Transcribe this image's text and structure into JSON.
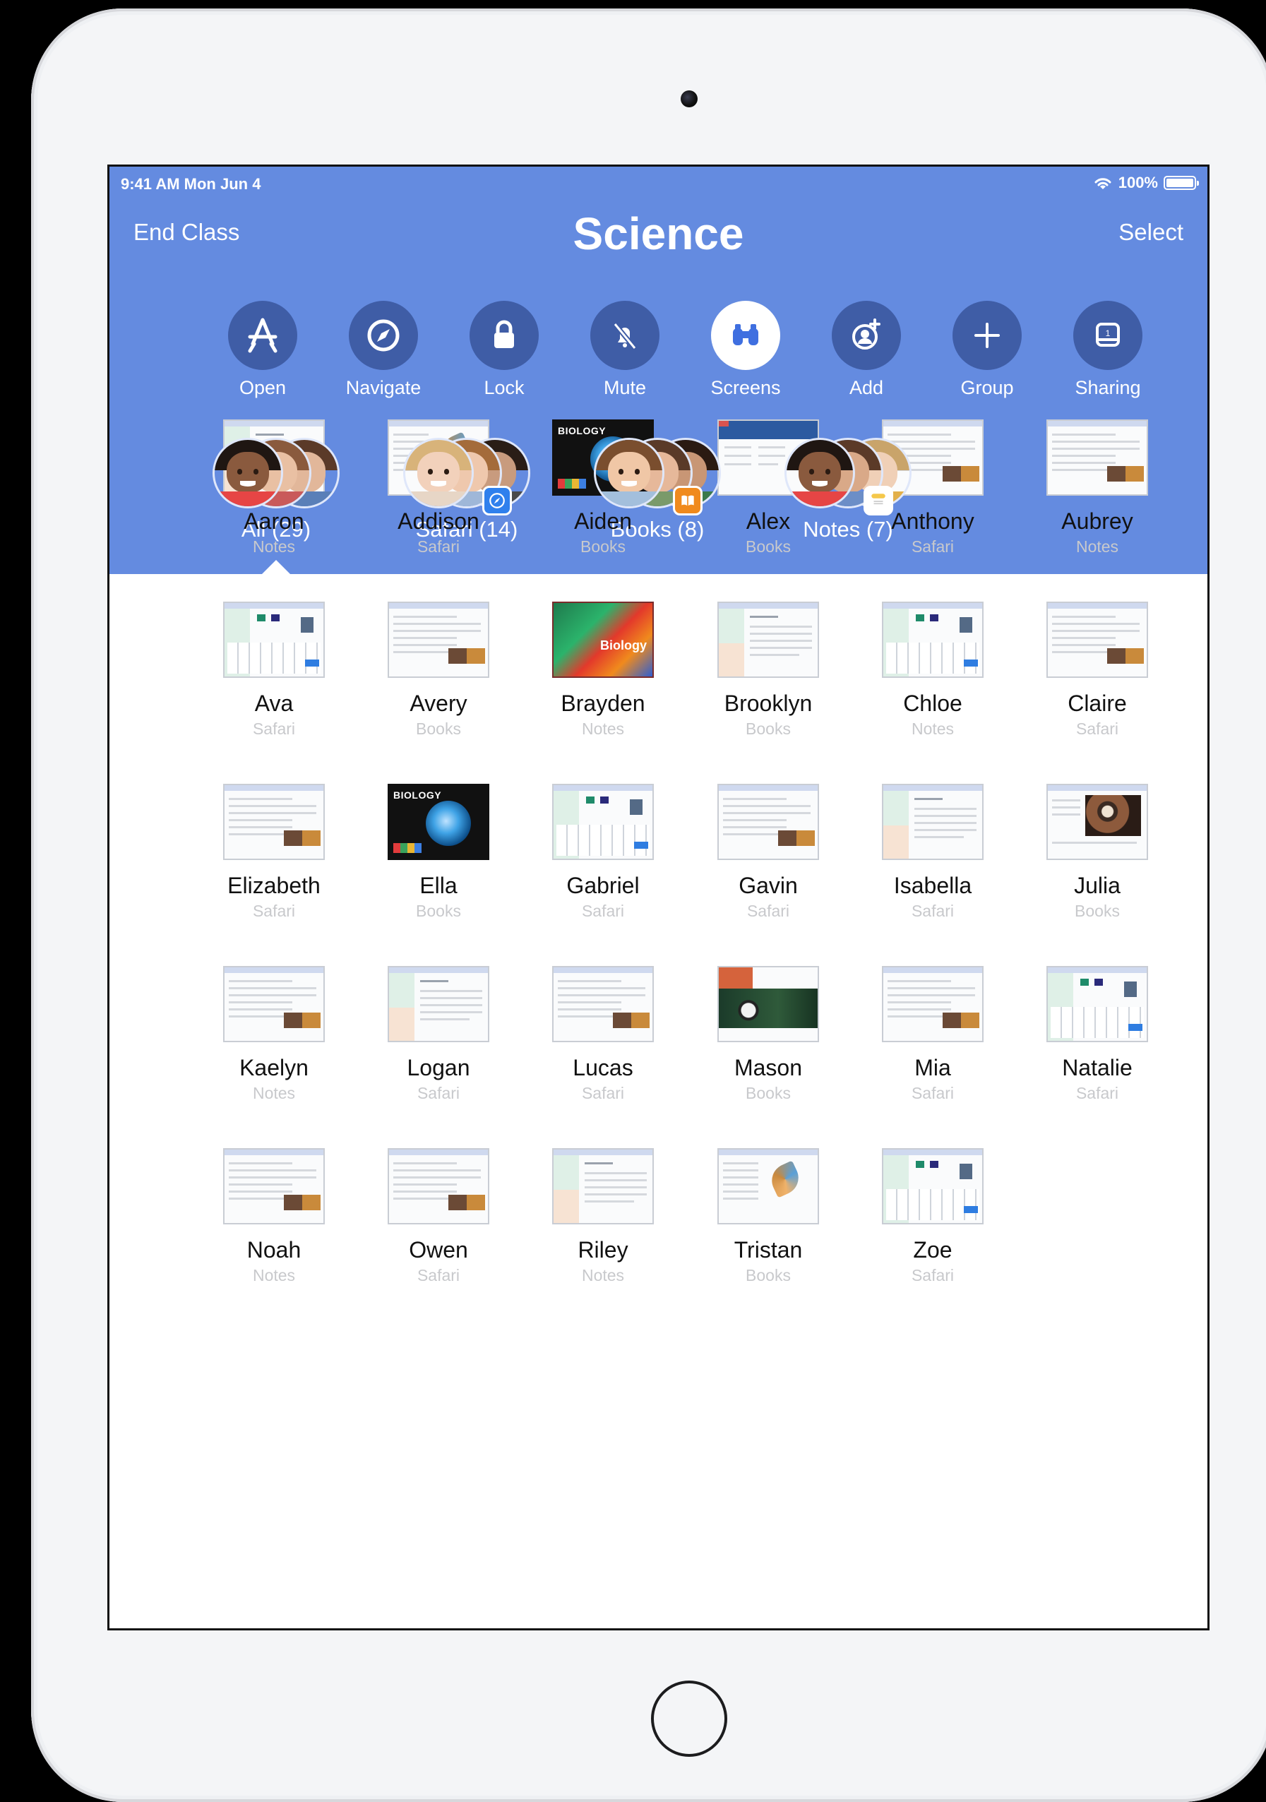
{
  "status": {
    "time": "9:41 AM   Mon Jun 4",
    "battery": "100%"
  },
  "nav": {
    "left": "End Class",
    "title": "Science",
    "right": "Select"
  },
  "tools": [
    {
      "label": "Open",
      "icon": "app-store-icon",
      "active": false
    },
    {
      "label": "Navigate",
      "icon": "compass-icon",
      "active": false
    },
    {
      "label": "Lock",
      "icon": "lock-icon",
      "active": false
    },
    {
      "label": "Mute",
      "icon": "mute-bell-icon",
      "active": false
    },
    {
      "label": "Screens",
      "icon": "binoculars-icon",
      "active": true
    },
    {
      "label": "Add",
      "icon": "add-person-icon",
      "active": false
    },
    {
      "label": "Group",
      "icon": "plus-icon",
      "active": false
    },
    {
      "label": "Sharing",
      "icon": "apple-tv-icon",
      "active": false
    }
  ],
  "filters": [
    {
      "label": "All (29)",
      "badge": null
    },
    {
      "label": "Safari (14)",
      "badge": "safari-badge-icon"
    },
    {
      "label": "Books (8)",
      "badge": "books-badge-icon"
    },
    {
      "label": "Notes (7)",
      "badge": "notes-badge-icon"
    }
  ],
  "students": [
    {
      "name": "Aaron",
      "app": "Notes",
      "thumb": "notes"
    },
    {
      "name": "Addison",
      "app": "Safari",
      "thumb": "bird"
    },
    {
      "name": "Aiden",
      "app": "Books",
      "thumb": "bio-dark"
    },
    {
      "name": "Alex",
      "app": "Books",
      "thumb": "web-blue"
    },
    {
      "name": "Anthony",
      "app": "Safari",
      "thumb": "web-img"
    },
    {
      "name": "Aubrey",
      "app": "Notes",
      "thumb": "web-img"
    },
    {
      "name": "Ava",
      "app": "Safari",
      "thumb": "keyboard"
    },
    {
      "name": "Avery",
      "app": "Books",
      "thumb": "web-img"
    },
    {
      "name": "Brayden",
      "app": "Notes",
      "thumb": "parrot"
    },
    {
      "name": "Brooklyn",
      "app": "Books",
      "thumb": "notes"
    },
    {
      "name": "Chloe",
      "app": "Notes",
      "thumb": "keyboard"
    },
    {
      "name": "Claire",
      "app": "Safari",
      "thumb": "web-img"
    },
    {
      "name": "Elizabeth",
      "app": "Safari",
      "thumb": "web-img"
    },
    {
      "name": "Ella",
      "app": "Books",
      "thumb": "bio-dark"
    },
    {
      "name": "Gabriel",
      "app": "Safari",
      "thumb": "keyboard"
    },
    {
      "name": "Gavin",
      "app": "Safari",
      "thumb": "web-img"
    },
    {
      "name": "Isabella",
      "app": "Safari",
      "thumb": "notes"
    },
    {
      "name": "Julia",
      "app": "Books",
      "thumb": "julia"
    },
    {
      "name": "Kaelyn",
      "app": "Notes",
      "thumb": "web-img"
    },
    {
      "name": "Logan",
      "app": "Safari",
      "thumb": "notes"
    },
    {
      "name": "Lucas",
      "app": "Safari",
      "thumb": "web-img"
    },
    {
      "name": "Mason",
      "app": "Books",
      "thumb": "mason"
    },
    {
      "name": "Mia",
      "app": "Safari",
      "thumb": "web-img"
    },
    {
      "name": "Natalie",
      "app": "Safari",
      "thumb": "keyboard"
    },
    {
      "name": "Noah",
      "app": "Notes",
      "thumb": "web-img"
    },
    {
      "name": "Owen",
      "app": "Safari",
      "thumb": "web-img"
    },
    {
      "name": "Riley",
      "app": "Notes",
      "thumb": "notes"
    },
    {
      "name": "Tristan",
      "app": "Books",
      "thumb": "bird"
    },
    {
      "name": "Zoe",
      "app": "Safari",
      "thumb": "keyboard"
    }
  ],
  "thumbnail_text": {
    "biology_title": "BIOLOGY",
    "biology_parrot": "Biology",
    "sharing_number": "1"
  },
  "colors": {
    "header": "#648be0",
    "tool_circle": "#3f5da6",
    "active_tool": "#ffffff",
    "safari_badge": "#2f80ed",
    "books_badge": "#f08a1d",
    "notes_badge": "#f5c84b"
  }
}
